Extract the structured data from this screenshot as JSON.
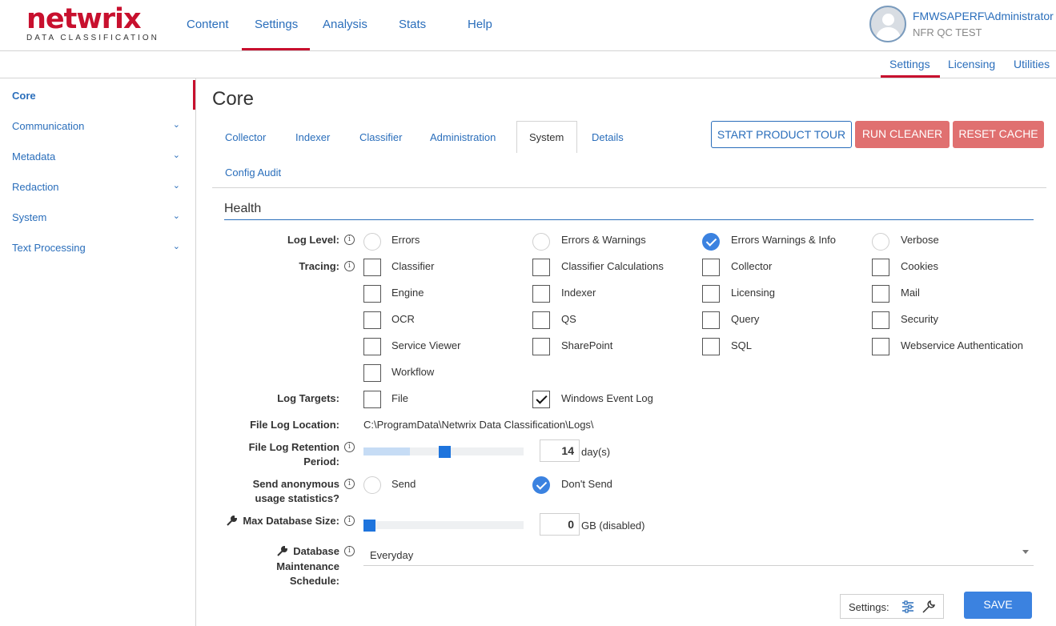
{
  "header": {
    "logo_word": "netwrix",
    "logo_sub": "DATA CLASSIFICATION",
    "nav": [
      "Content",
      "Settings",
      "Analysis",
      "Stats",
      "Help"
    ],
    "user_name": "FMWSAPERF\\Administrator",
    "user_org": "NFR QC TEST"
  },
  "subnav": [
    "Settings",
    "Licensing",
    "Utilities"
  ],
  "sidebar": {
    "items": [
      {
        "label": "Core",
        "active": true
      },
      {
        "label": "Communication"
      },
      {
        "label": "Metadata"
      },
      {
        "label": "Redaction"
      },
      {
        "label": "System"
      },
      {
        "label": "Text Processing"
      }
    ],
    "chevron": "⌄"
  },
  "main": {
    "title": "Core",
    "tabs": [
      "Collector",
      "Indexer",
      "Classifier",
      "Administration",
      "System",
      "Details",
      "Config Audit"
    ],
    "active_tab": "System",
    "buttons": {
      "tour": "START PRODUCT TOUR",
      "cleaner": "RUN CLEANER",
      "cache": "RESET CACHE"
    },
    "section": "Health",
    "info_glyph": "i",
    "log_level": {
      "label": "Log Level:",
      "options": [
        "Errors",
        "Errors & Warnings",
        "Errors Warnings & Info",
        "Verbose"
      ],
      "selected": "Errors Warnings & Info"
    },
    "tracing": {
      "label": "Tracing:",
      "options": [
        "Classifier",
        "Classifier Calculations",
        "Collector",
        "Cookies",
        "Engine",
        "Indexer",
        "Licensing",
        "Mail",
        "OCR",
        "QS",
        "Query",
        "Security",
        "Service Viewer",
        "SharePoint",
        "SQL",
        "Webservice Authentication",
        "Workflow"
      ]
    },
    "log_targets": {
      "label": "Log Targets:",
      "options": [
        "File",
        "Windows Event Log"
      ],
      "checked": [
        "Windows Event Log"
      ]
    },
    "file_log_location": {
      "label": "File Log Location:",
      "value": "C:\\ProgramData\\Netwrix Data Classification\\Logs\\"
    },
    "retention": {
      "label_1": "File Log Retention",
      "label_2": "Period:",
      "value": "14",
      "unit": "day(s)",
      "slider_fraction": 0.25
    },
    "anonymous": {
      "label_1": "Send anonymous",
      "label_2": "usage statistics?",
      "options": [
        "Send",
        "Don't Send"
      ],
      "selected": "Don't Send"
    },
    "max_db": {
      "label": "Max Database Size:",
      "value": "0",
      "unit": "GB (disabled)",
      "slider_fraction": 0
    },
    "schedule": {
      "label_1": "Database",
      "label_2": "Maintenance",
      "label_3": "Schedule:",
      "value": "Everyday"
    },
    "footer": {
      "settings_label": "Settings:",
      "save": "SAVE"
    }
  },
  "colors": {
    "brand_red": "#c8102e",
    "link_blue": "#2a6ebb",
    "accent_blue": "#3b82e0",
    "danger_button": "#e07070"
  }
}
